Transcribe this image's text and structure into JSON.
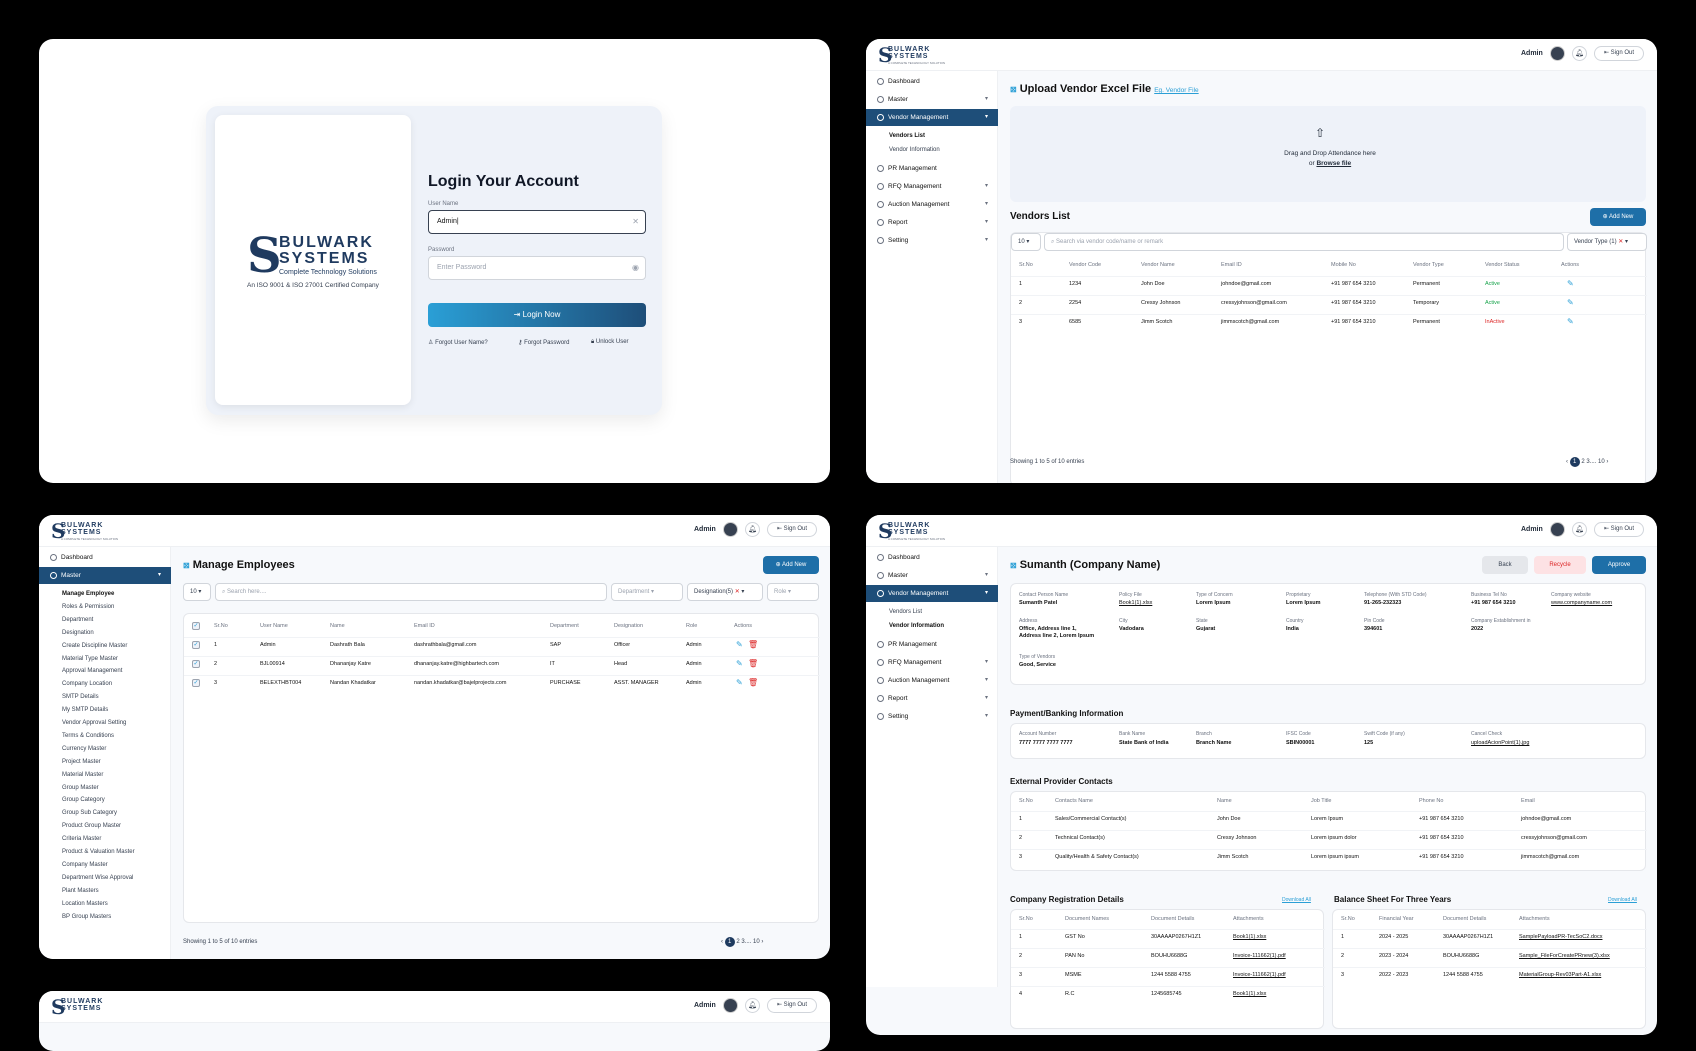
{
  "logo": {
    "line1": "BULWARK",
    "line2": "SYSTEMS",
    "tagline": "Complete Technology Solutions",
    "iso": "An ISO 9001 & ISO 27001 Certified Company",
    "mini_tag": "A COMPLETE TECHNOLOGY SOLUTION"
  },
  "login": {
    "title": "Login Your Account",
    "username_label": "User Name",
    "username_value": "Admin|",
    "password_label": "Password",
    "password_placeholder": "Enter Password",
    "button": "Login Now",
    "forgot_user": "Forgot User Name?",
    "forgot_password": "Forgot Password",
    "unlock": "Unlock User"
  },
  "header": {
    "user": "Admin",
    "sign_out": "Sign Out"
  },
  "sidebar": {
    "dashboard": "Dashboard",
    "master": "Master",
    "vendor_management": "Vendor Management",
    "vendors_list": "Vendors List",
    "vendor_information": "Vendor Information",
    "pr_management": "PR Management",
    "rfq_management": "RFQ Management",
    "auction_management": "Auction Management",
    "report": "Report",
    "setting": "Setting"
  },
  "vendor": {
    "upload_title": "Upload Vendor Excel File",
    "upload_link": "Eg. Vendor File",
    "drop_text": "Drag and Drop Attendance here",
    "or": "or",
    "browse": "Browse file",
    "list_title": "Vendors List",
    "add_new": "Add New",
    "page_size": "10",
    "search_placeholder": "Search via vendor code/name or remark",
    "filter": "Vendor Type (1)",
    "columns": [
      "Sr.No",
      "Vendor Code",
      "Vendor Name",
      "Email ID",
      "Mobile No",
      "Vendor Type",
      "Vendor Status",
      "Actions"
    ],
    "rows": [
      [
        "1",
        "1234",
        "John Doe",
        "johndoe@gmail.com",
        "+91 987 654 3210",
        "Permanent",
        "Active"
      ],
      [
        "2",
        "2254",
        "Cressy Johnson",
        "cressyjohnson@gmail.com",
        "+91 987 654 3210",
        "Temporary",
        "Active"
      ],
      [
        "3",
        "6585",
        "Jimm Scotch",
        "jimmscotch@gmail.com",
        "+91 987 654 3210",
        "Permanent",
        "InActive"
      ]
    ],
    "showing": "Showing 1 to 5 of 10 entries",
    "pages": [
      "1",
      "2",
      "3....",
      "10"
    ]
  },
  "employees": {
    "title": "Manage Employees",
    "add_new": "Add New",
    "page_size": "10",
    "search_placeholder": "Search here....",
    "department": "Department",
    "designation": "Designation(5)",
    "role": "Role",
    "submenu": [
      "Manage Employee",
      "Roles & Permission",
      "Department",
      "Designation",
      "Create Discipline Master",
      "Material Type Master",
      "Approval Management",
      "Company Location",
      "SMTP Details",
      "My SMTP Details",
      "Vendor Approval Setting",
      "Terms & Conditions",
      "Currency Master",
      "Project Master",
      "Material Master",
      "Group Master",
      "Group Category",
      "Group Sub Category",
      "Product Group Master",
      "Criteria Master",
      "Product & Valuation Master",
      "Company Master",
      "Department Wise Approval",
      "Plant Masters",
      "Location Masters",
      "BP Group Masters"
    ],
    "columns": [
      "Sr.No",
      "User Name",
      "Name",
      "Email ID",
      "Department",
      "Designation",
      "Role",
      "Actions"
    ],
    "rows": [
      [
        "1",
        "Admin",
        "Dashrath Bala",
        "dashrathbala@gmail.com",
        "SAP",
        "Officer",
        "Admin"
      ],
      [
        "2",
        "BJL00914",
        "Dhananjay Katre",
        "dhananjay.katre@highbartech.com",
        "IT",
        "Head",
        "Admin"
      ],
      [
        "3",
        "BELEXTHBT004",
        "Nandan Khadatkar",
        "nandan.khadatkar@bajelprojects.com",
        "PURCHASE",
        "ASST. MANAGER",
        "Admin"
      ]
    ],
    "showing": "Showing 1 to 5 of 10 entries",
    "pages": [
      "1",
      "2",
      "3....",
      "10"
    ]
  },
  "detail": {
    "title": "Sumanth (Company Name)",
    "back": "Back",
    "recycle": "Recycle",
    "approve": "Approve",
    "fields": [
      [
        "Contact Person Name",
        "Sumanth Patel"
      ],
      [
        "Policy File",
        "Book1(1).xlsx"
      ],
      [
        "Type of Concern",
        "Lorem Ipsum"
      ],
      [
        "Proprietary",
        "Lorem Ipsum"
      ],
      [
        "Telephone (With STD Code)",
        "91-265-232323"
      ],
      [
        "Business Tel No",
        "+91 987 654 3210"
      ],
      [
        "Company website",
        "www.companyname.com"
      ]
    ],
    "address_label": "Address",
    "address_1": "Office, Address line 1,",
    "address_2": "Address line 2, Lorem Ipsum",
    "city_label": "City",
    "city": "Vadodara",
    "state_label": "State",
    "state": "Gujarat",
    "country_label": "Country",
    "country": "India",
    "pin_label": "Pin Code",
    "pin": "394601",
    "est_label": "Company Establishment in",
    "est": "2022",
    "vendor_type_label": "Type of Vendors",
    "vendor_type": "Good, Service",
    "banking_title": "Payment/Banking Information",
    "banking": [
      [
        "Account Number",
        "7777 7777 7777 7777"
      ],
      [
        "Bank Name",
        "State Bank of India"
      ],
      [
        "Branch",
        "Branch Name"
      ],
      [
        "IFSC Code",
        "SBIN00001"
      ],
      [
        "Swift Code (if any)",
        "125"
      ],
      [
        "Cancel Check",
        "uploadAcionPoint(1).jpg"
      ]
    ],
    "contacts_title": "External Provider Contacts",
    "contact_columns": [
      "Sr.No",
      "Contacts Name",
      "Name",
      "Job Title",
      "Phone No",
      "Email"
    ],
    "contact_rows": [
      [
        "1",
        "Sales/Commercial Contact(s)",
        "John Doe",
        "Lorem Ipsum",
        "+91 987 654 3210",
        "johndoe@gmail.com"
      ],
      [
        "2",
        "Technical Contact(s)",
        "Cressy Johnson",
        "Lorem ipsum dolor",
        "+91 987 654 3210",
        "cressyjohnson@gmail.com"
      ],
      [
        "3",
        "Quality/Health & Safety Contact(s)",
        "Jimm Scotch",
        "Lorem ipsum ipsum",
        "+91 987 654 3210",
        "jimmscotch@gmail.com"
      ]
    ],
    "reg_title": "Company Registration Details",
    "download_all": "Download All",
    "reg_columns": [
      "Sr.No",
      "Document Names",
      "Document Details",
      "Attachments"
    ],
    "reg_rows": [
      [
        "1",
        "GST No",
        "30AAAAP0267H1Z1",
        "Book1(1).xlsx"
      ],
      [
        "2",
        "PAN No",
        "BOUHU6688G",
        "Invoice-111662(1).pdf"
      ],
      [
        "3",
        "MSME",
        "1244 5588 4755",
        "Invoice-111662(1).pdf"
      ],
      [
        "4",
        "R.C",
        "1245685745",
        "Book1(1).xlsx"
      ]
    ],
    "bal_title": "Balance Sheet For Three Years",
    "bal_columns": [
      "Sr.No",
      "Financial Year",
      "Document Details",
      "Attachments"
    ],
    "bal_rows": [
      [
        "1",
        "2024 - 2025",
        "30AAAAP0267H1Z1",
        "SamplePayloadPR-TecSoC2.docx"
      ],
      [
        "2",
        "2023 - 2024",
        "BOUHU6688G",
        "Sample_FileForCreatePRnew(3).xlsx"
      ],
      [
        "3",
        "2022 - 2023",
        "1244 5588 4755",
        "MaterialGroup-Rev03Part-A1.xlsx"
      ]
    ]
  },
  "colors": {
    "primary": "#1e4e79",
    "accent": "#2a9fd6",
    "active": "#16a34a",
    "inactive": "#dc2626"
  }
}
